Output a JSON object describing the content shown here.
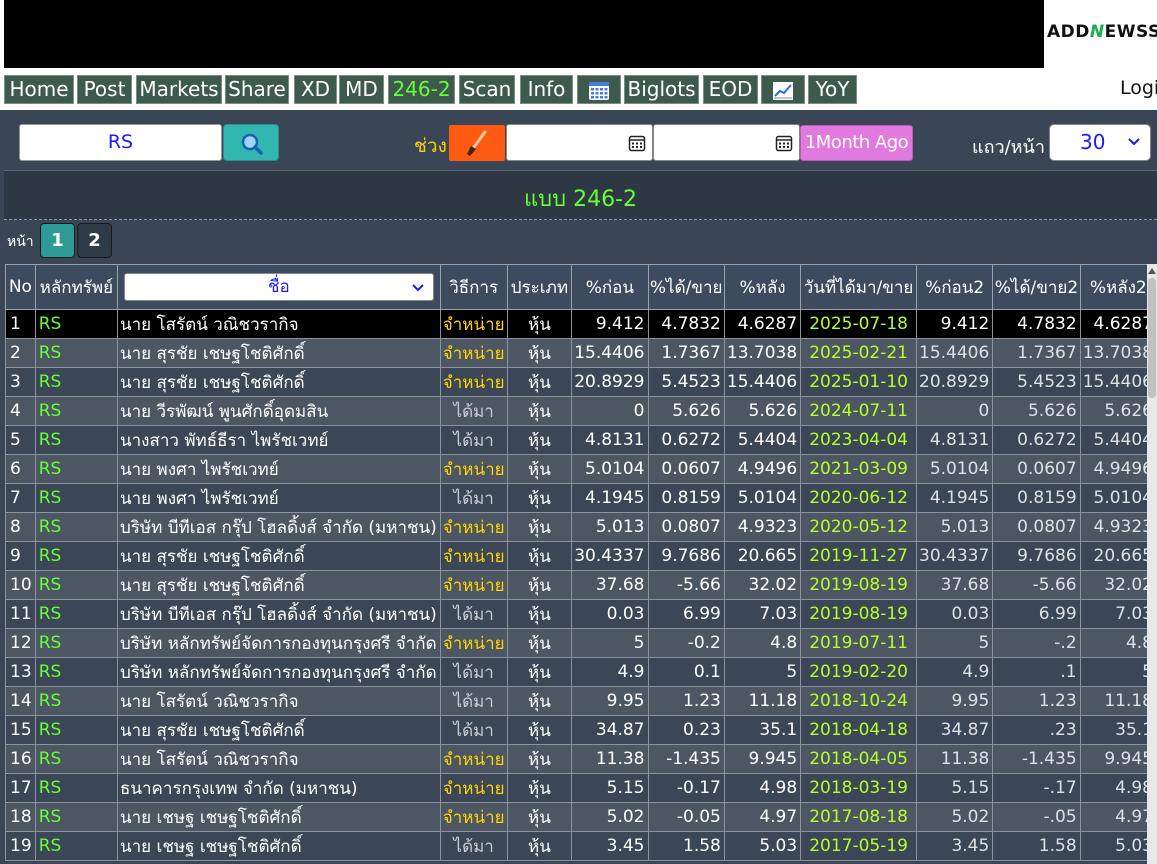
{
  "logo": {
    "pre": "ADD",
    "n": "N",
    "post": "EWSS"
  },
  "nav": [
    {
      "label": "Home"
    },
    {
      "label": "Post"
    },
    {
      "label": "Markets"
    },
    {
      "label": "Share"
    },
    {
      "label": "XD"
    },
    {
      "label": "MD"
    },
    {
      "label": "246-2",
      "active": true
    },
    {
      "label": "Scan"
    },
    {
      "label": "Info"
    },
    {
      "icon": "grid-calendar-icon"
    },
    {
      "label": "Biglots"
    },
    {
      "label": "EOD"
    },
    {
      "icon": "chart-icon"
    },
    {
      "label": "YoY"
    }
  ],
  "login": "Login",
  "filters": {
    "symbol_value": "RS",
    "range_label": "ช่วง",
    "start_date": "",
    "end_date": "",
    "month_ago_label": "1Month Ago",
    "rows_label": "แถว/หน้า",
    "rows_value": "30"
  },
  "title": "แบบ 246-2",
  "pagination": {
    "label": "หน้า",
    "pages": [
      "1",
      "2"
    ],
    "current": "1"
  },
  "table": {
    "headers": [
      "No",
      "หลักทรัพย์",
      "ชื่อ",
      "วิธีการ",
      "ประเภท",
      "%ก่อน",
      "%ได้/ขาย",
      "%หลัง",
      "วันที่ได้มา/ขาย",
      "%ก่อน2",
      "%ได้/ขาย2",
      "%หลัง2"
    ],
    "rows": [
      [
        "1",
        "RS",
        "นาย โสรัตน์ วณิชวรากิจ",
        "จำหน่าย",
        "หุ้น",
        "9.412",
        "4.7832",
        "4.6287",
        "2025-07-18",
        "9.412",
        "4.7832",
        "4.6287"
      ],
      [
        "2",
        "RS",
        "นาย สุรชัย เชษฐโชติศักดิ์",
        "จำหน่าย",
        "หุ้น",
        "15.4406",
        "1.7367",
        "13.7038",
        "2025-02-21",
        "15.4406",
        "1.7367",
        "13.7038"
      ],
      [
        "3",
        "RS",
        "นาย สุรชัย เชษฐโชติศักดิ์",
        "จำหน่าย",
        "หุ้น",
        "20.8929",
        "5.4523",
        "15.4406",
        "2025-01-10",
        "20.8929",
        "5.4523",
        "15.4406"
      ],
      [
        "4",
        "RS",
        "นาย วีรพัฒน์ พูนศักดิ์อุดมสิน",
        "ได้มา",
        "หุ้น",
        "0",
        "5.626",
        "5.626",
        "2024-07-11",
        "0",
        "5.626",
        "5.626"
      ],
      [
        "5",
        "RS",
        "นางสาว พัทธ์ธีรา ไพรัชเวทย์",
        "ได้มา",
        "หุ้น",
        "4.8131",
        "0.6272",
        "5.4404",
        "2023-04-04",
        "4.8131",
        "0.6272",
        "5.4404"
      ],
      [
        "6",
        "RS",
        "นาย พงศา ไพรัชเวทย์",
        "จำหน่าย",
        "หุ้น",
        "5.0104",
        "0.0607",
        "4.9496",
        "2021-03-09",
        "5.0104",
        "0.0607",
        "4.9496"
      ],
      [
        "7",
        "RS",
        "นาย พงศา ไพรัชเวทย์",
        "ได้มา",
        "หุ้น",
        "4.1945",
        "0.8159",
        "5.0104",
        "2020-06-12",
        "4.1945",
        "0.8159",
        "5.0104"
      ],
      [
        "8",
        "RS",
        "บริษัท บีทีเอส กรุ๊ป โฮลดิ้งส์ จำกัด (มหาชน)",
        "จำหน่าย",
        "หุ้น",
        "5.013",
        "0.0807",
        "4.9323",
        "2020-05-12",
        "5.013",
        "0.0807",
        "4.9323"
      ],
      [
        "9",
        "RS",
        "นาย สุรชัย เชษฐโชติศักดิ์",
        "จำหน่าย",
        "หุ้น",
        "30.4337",
        "9.7686",
        "20.665",
        "2019-11-27",
        "30.4337",
        "9.7686",
        "20.665"
      ],
      [
        "10",
        "RS",
        "นาย สุรชัย เชษฐโชติศักดิ์",
        "จำหน่าย",
        "หุ้น",
        "37.68",
        "-5.66",
        "32.02",
        "2019-08-19",
        "37.68",
        "-5.66",
        "32.02"
      ],
      [
        "11",
        "RS",
        "บริษัท บีทีเอส กรุ๊ป โฮลดิ้งส์ จำกัด (มหาชน)",
        "ได้มา",
        "หุ้น",
        "0.03",
        "6.99",
        "7.03",
        "2019-08-19",
        "0.03",
        "6.99",
        "7.03"
      ],
      [
        "12",
        "RS",
        "บริษัท หลักทรัพย์จัดการกองทุนกรุงศรี จำกัด",
        "จำหน่าย",
        "หุ้น",
        "5",
        "-0.2",
        "4.8",
        "2019-07-11",
        "5",
        "-.2",
        "4.8"
      ],
      [
        "13",
        "RS",
        "บริษัท หลักทรัพย์จัดการกองทุนกรุงศรี จำกัด",
        "ได้มา",
        "หุ้น",
        "4.9",
        "0.1",
        "5",
        "2019-02-20",
        "4.9",
        ".1",
        "5"
      ],
      [
        "14",
        "RS",
        "นาย โสรัตน์ วณิชวรากิจ",
        "ได้มา",
        "หุ้น",
        "9.95",
        "1.23",
        "11.18",
        "2018-10-24",
        "9.95",
        "1.23",
        "11.18"
      ],
      [
        "15",
        "RS",
        "นาย สุรชัย เชษฐโชติศักดิ์",
        "ได้มา",
        "หุ้น",
        "34.87",
        "0.23",
        "35.1",
        "2018-04-18",
        "34.87",
        ".23",
        "35.1"
      ],
      [
        "16",
        "RS",
        "นาย โสรัตน์ วณิชวรากิจ",
        "จำหน่าย",
        "หุ้น",
        "11.38",
        "-1.435",
        "9.945",
        "2018-04-05",
        "11.38",
        "-1.435",
        "9.945"
      ],
      [
        "17",
        "RS",
        "ธนาคารกรุงเทพ จำกัด (มหาชน)",
        "จำหน่าย",
        "หุ้น",
        "5.15",
        "-0.17",
        "4.98",
        "2018-03-19",
        "5.15",
        "-.17",
        "4.98"
      ],
      [
        "18",
        "RS",
        "นาย เชษฐ เชษฐโชติศักดิ์",
        "จำหน่าย",
        "หุ้น",
        "5.02",
        "-0.05",
        "4.97",
        "2017-08-18",
        "5.02",
        "-.05",
        "4.97"
      ],
      [
        "19",
        "RS",
        "นาย เชษฐ เชษฐโชติศักดิ์",
        "ได้มา",
        "หุ้น",
        "3.45",
        "1.58",
        "5.03",
        "2017-05-19",
        "3.45",
        "1.58",
        "5.03"
      ]
    ]
  },
  "colors": {
    "accent_green": "#66ff33",
    "sell_yellow": "#ffd400",
    "date_green": "#b7ff2a",
    "teal": "#31b6b0",
    "orange": "#ff5a12",
    "pink": "#e07adf"
  }
}
